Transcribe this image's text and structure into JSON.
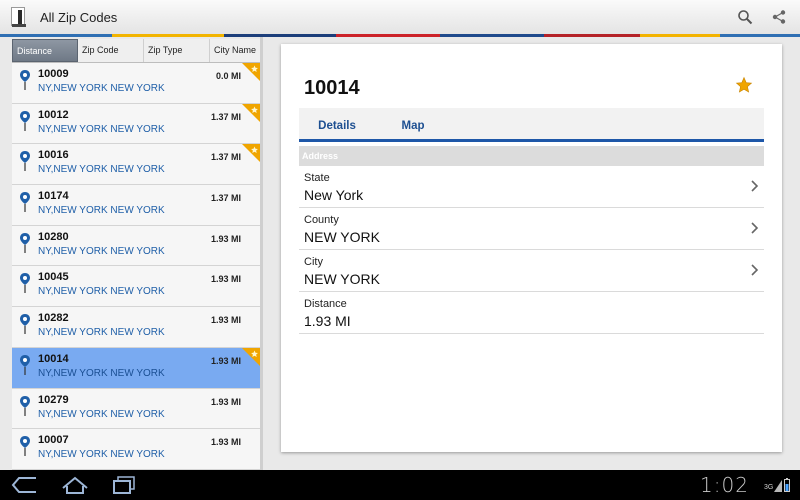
{
  "app": {
    "title": "All Zip Codes"
  },
  "actionbar": {
    "search_icon": "search-icon",
    "share_icon": "share-icon"
  },
  "sort_tabs": [
    {
      "label": "Distance",
      "active": true
    },
    {
      "label": "Zip Code",
      "active": false
    },
    {
      "label": "Zip Type",
      "active": false
    },
    {
      "label": "City Name",
      "active": false
    }
  ],
  "zip_list": [
    {
      "zip": "10009",
      "place": "NY,NEW YORK NEW YORK",
      "distance": "0.0 MI",
      "favorite": true,
      "selected": false
    },
    {
      "zip": "10012",
      "place": "NY,NEW YORK NEW YORK",
      "distance": "1.37 MI",
      "favorite": true,
      "selected": false
    },
    {
      "zip": "10016",
      "place": "NY,NEW YORK NEW YORK",
      "distance": "1.37 MI",
      "favorite": true,
      "selected": false
    },
    {
      "zip": "10174",
      "place": "NY,NEW YORK NEW YORK",
      "distance": "1.37 MI",
      "favorite": false,
      "selected": false
    },
    {
      "zip": "10280",
      "place": "NY,NEW YORK NEW YORK",
      "distance": "1.93 MI",
      "favorite": false,
      "selected": false
    },
    {
      "zip": "10045",
      "place": "NY,NEW YORK NEW YORK",
      "distance": "1.93 MI",
      "favorite": false,
      "selected": false
    },
    {
      "zip": "10282",
      "place": "NY,NEW YORK NEW YORK",
      "distance": "1.93 MI",
      "favorite": false,
      "selected": false
    },
    {
      "zip": "10014",
      "place": "NY,NEW YORK NEW YORK",
      "distance": "1.93 MI",
      "favorite": true,
      "selected": true
    },
    {
      "zip": "10279",
      "place": "NY,NEW YORK NEW YORK",
      "distance": "1.93 MI",
      "favorite": false,
      "selected": false
    },
    {
      "zip": "10007",
      "place": "NY,NEW YORK NEW YORK",
      "distance": "1.93 MI",
      "favorite": false,
      "selected": false
    }
  ],
  "detail": {
    "title": "10014",
    "favorite": true,
    "tabs": [
      {
        "label": "Details",
        "active": true
      },
      {
        "label": "Map",
        "active": false
      }
    ],
    "section_header": "Address",
    "rows": [
      {
        "label": "State",
        "value": "New York",
        "has_chevron": true
      },
      {
        "label": "County",
        "value": "NEW YORK",
        "has_chevron": true
      },
      {
        "label": "City",
        "value": "NEW YORK",
        "has_chevron": true
      },
      {
        "label": "Distance",
        "value": "1.93 MI",
        "has_chevron": false
      }
    ]
  },
  "system_bar": {
    "time": "1:02",
    "network": "3G"
  },
  "colors": {
    "accent_blue": "#1e57a8",
    "selected_row": "#79aaf1",
    "star": "#f0a500",
    "link_blue": "#1f5fa8"
  }
}
